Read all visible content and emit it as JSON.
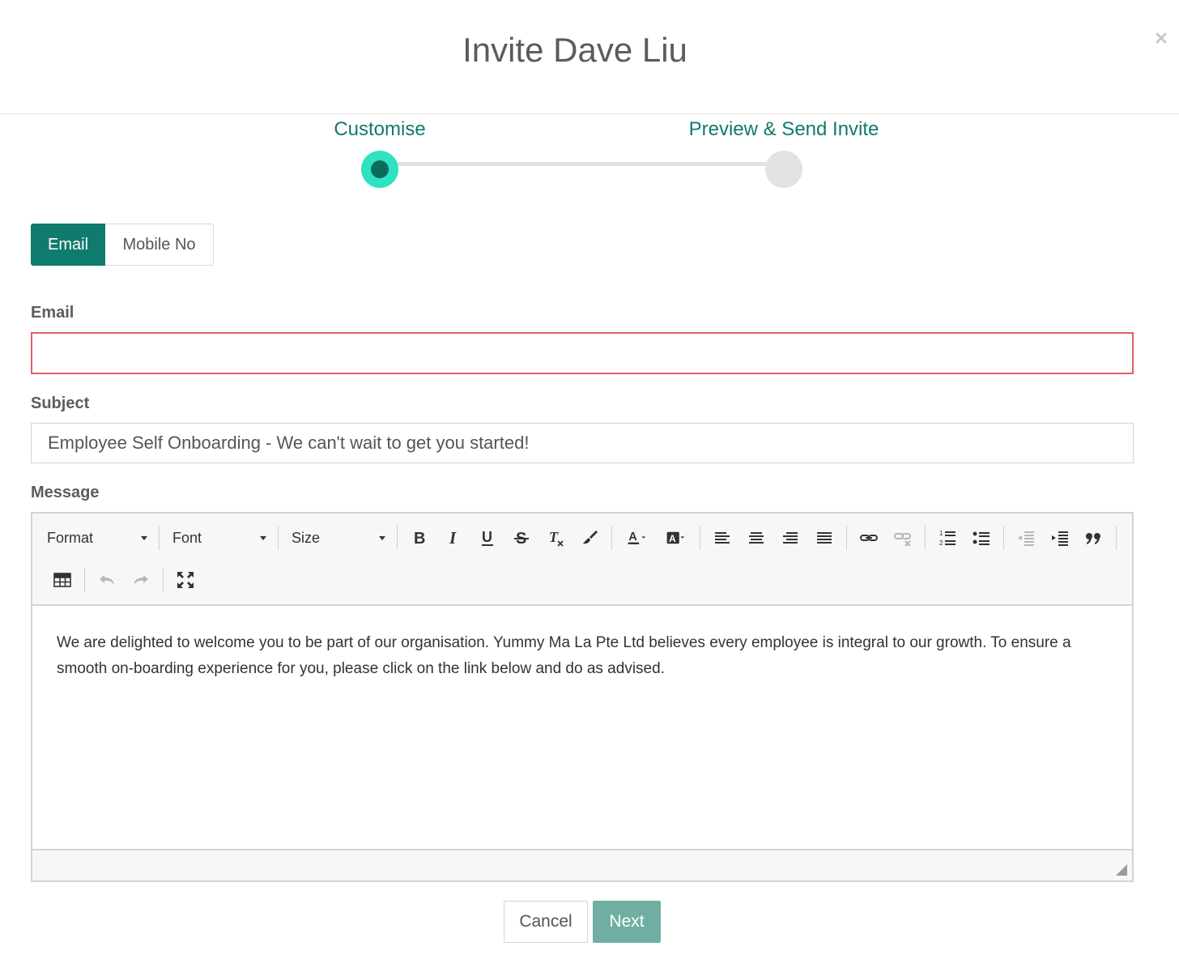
{
  "modal": {
    "title": "Invite Dave Liu"
  },
  "stepper": {
    "steps": [
      {
        "label": "Customise",
        "state": "active"
      },
      {
        "label": "Preview & Send Invite",
        "state": "inactive"
      }
    ]
  },
  "channel_toggle": {
    "options": [
      "Email",
      "Mobile No"
    ],
    "selected": "Email"
  },
  "form": {
    "email": {
      "label": "Email",
      "value": "",
      "placeholder": ""
    },
    "subject": {
      "label": "Subject",
      "value": "Employee Self Onboarding - We can't wait to get you started!"
    },
    "message": {
      "label": "Message",
      "toolbar": {
        "format_label": "Format",
        "font_label": "Font",
        "size_label": "Size"
      },
      "body": "We are delighted to welcome you to be part of our organisation. Yummy Ma La Pte Ltd believes every employee is integral to our growth. To ensure a smooth on-boarding experience for you, please click on the link below and do as advised."
    }
  },
  "footer": {
    "cancel_label": "Cancel",
    "next_label": "Next"
  },
  "colors": {
    "accent": "#0f7b6c",
    "step_active": "#2de3c1",
    "error_border": "#e15e6c",
    "next_button": "#70aea2"
  }
}
